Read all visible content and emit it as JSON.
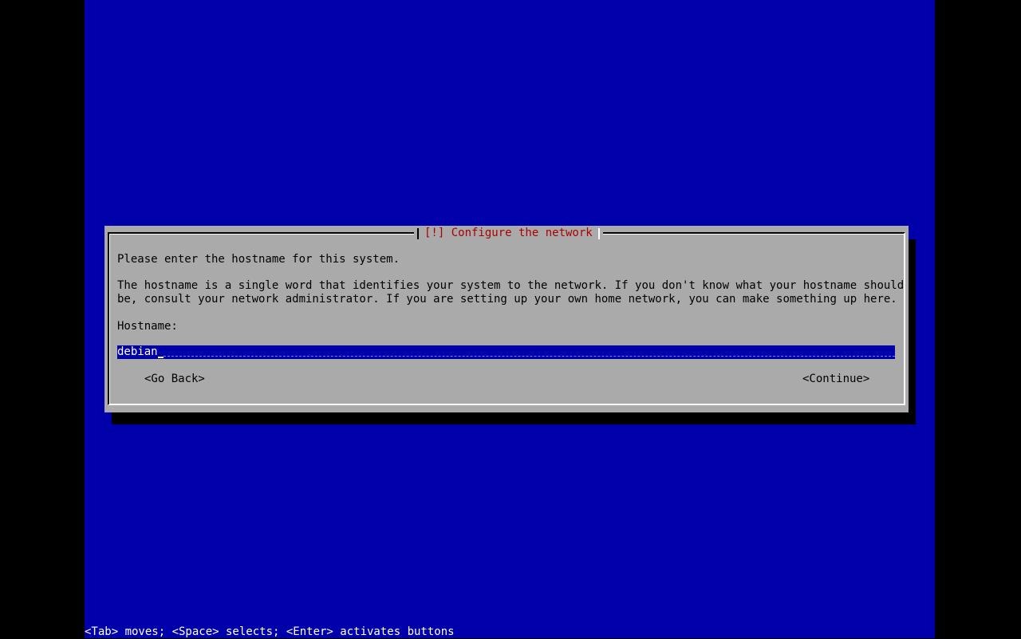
{
  "colors": {
    "background": "#0000aa",
    "dialog": "#aaaaaa",
    "title": "#aa0000",
    "field": "#0000aa"
  },
  "dialog": {
    "title": "[!] Configure the network",
    "prompt": "Please enter the hostname for this system.",
    "description_line1": "The hostname is a single word that identifies your system to the network. If you don't know what your hostname should",
    "description_line2": "be, consult your network administrator. If you are setting up your own home network, you can make something up here.",
    "field_label": "Hostname:",
    "field_value": "debian",
    "go_back_label": "<Go Back>",
    "continue_label": "<Continue>"
  },
  "help_bar": {
    "text": "<Tab> moves; <Space> selects; <Enter> activates buttons"
  }
}
